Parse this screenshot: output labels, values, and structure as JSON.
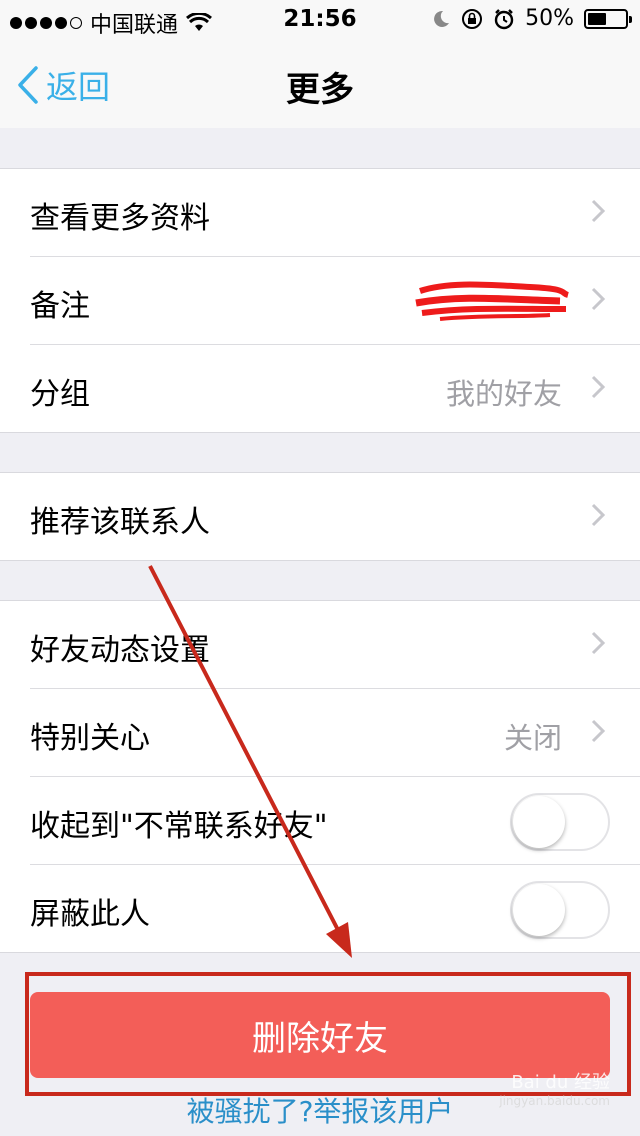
{
  "status_bar": {
    "carrier": "中国联通",
    "time": "21:56",
    "battery": "50%",
    "battery_level": 0.5
  },
  "nav": {
    "back_label": "返回",
    "title": "更多"
  },
  "group1": [
    {
      "label": "查看更多资料",
      "value": ""
    },
    {
      "label": "备注",
      "value": ""
    },
    {
      "label": "分组",
      "value": "我的好友"
    }
  ],
  "group2": [
    {
      "label": "推荐该联系人",
      "value": ""
    }
  ],
  "group3": [
    {
      "label": "好友动态设置",
      "value": ""
    },
    {
      "label": "特别关心",
      "value": "关闭"
    },
    {
      "label": "收起到\"不常联系好友\"",
      "toggle": false
    },
    {
      "label": "屏蔽此人",
      "toggle": false
    }
  ],
  "delete_button": "删除好友",
  "report_link": "被骚扰了?举报该用户",
  "watermark": {
    "text": "Bai du 经验",
    "sub": "jingyan.baidu.com"
  },
  "colors": {
    "accent": "#3ab0e8",
    "danger": "#f35e58",
    "annotation": "#c8291c"
  },
  "icons": [
    "wifi-icon",
    "moon-icon",
    "orientation-lock-icon",
    "alarm-icon",
    "battery-icon",
    "back-chevron-icon",
    "chevron-right-icon"
  ]
}
